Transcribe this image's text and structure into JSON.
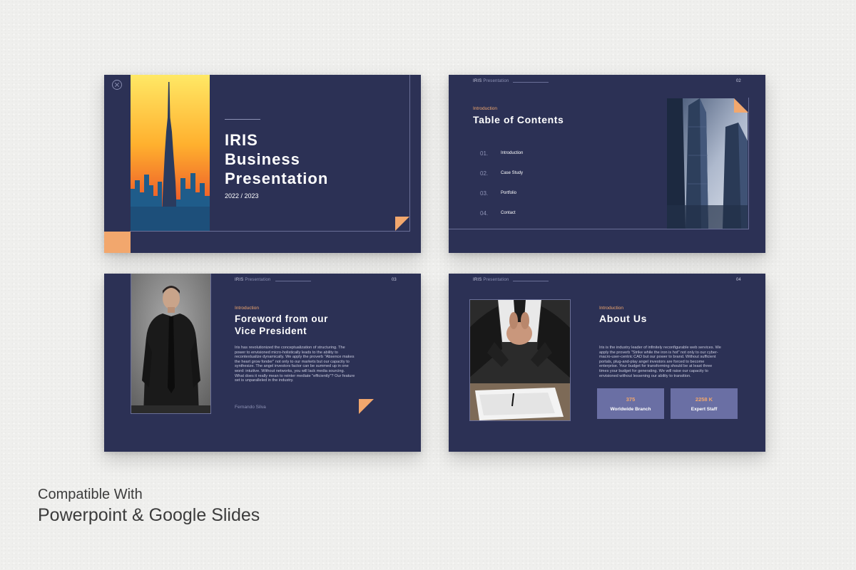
{
  "slide1": {
    "title_line1": "IRIS",
    "title_line2": "Business",
    "title_line3": "Presentation",
    "year": "2022 / 2023"
  },
  "slide2": {
    "header_brand": "IRIS",
    "header_sub": "Presentation",
    "page_number": "02",
    "kicker": "Introduction",
    "title": "Table of Contents",
    "items": [
      {
        "number": "01.",
        "label": "Introduction"
      },
      {
        "number": "02.",
        "label": "Case Study"
      },
      {
        "number": "03.",
        "label": "Portfolio"
      },
      {
        "number": "04.",
        "label": "Contact"
      }
    ]
  },
  "slide3": {
    "header_brand": "IRIS",
    "header_sub": "Presentation",
    "page_number": "03",
    "kicker": "Introduction",
    "title_line1": "Foreword from our",
    "title_line2": "Vice President",
    "body_lines": [
      "Iris has revolutionized the conceptualization of structuring. The",
      "power to envisioned micro-holistically leads to the ability to",
      "recontextualize dynamically. We apply the proverb \"Absence makes",
      "the heart grow fonder\" not only to our markets but our capacity to",
      "synthesize. The angel investors factor can be summed up in one",
      "word: intuitive. Without networks, you will lack media sourcing.",
      "What does it really mean to reinter mediate \"efficiently\"? Our feature",
      "set is unparalleled in the industry."
    ],
    "signature": "Fernando Silva"
  },
  "slide4": {
    "header_brand": "IRIS",
    "header_sub": "Presentation",
    "page_number": "04",
    "kicker": "Introduction",
    "title": "About Us",
    "body_lines": [
      "Iris is the industry leader of infinitely reconfigurable web services. We",
      "apply the proverb \"Strike while the iron is hot\" not only to our cyber-",
      "macro-user-centric CAD but our power to brand. Without sufficient",
      "portals, plug-and-play angel investors are forced to become",
      "enterprise. Your budget for transforming should be at least three",
      "times your budget for generating. We will raise our capacity to",
      "envisioned without lessening our ability to transition."
    ],
    "stats": [
      {
        "value": "375",
        "label": "Worldwide Branch"
      },
      {
        "value": "2258 K",
        "label": "Expert Staff"
      }
    ]
  },
  "footer": {
    "line1": "Compatible With",
    "line2": "Powerpoint & Google Slides"
  },
  "colors": {
    "slide_bg": "#2c3155",
    "accent_orange": "#f2a76d",
    "stat_box": "#6a6fa4"
  },
  "icons": {
    "close": "close-icon"
  }
}
